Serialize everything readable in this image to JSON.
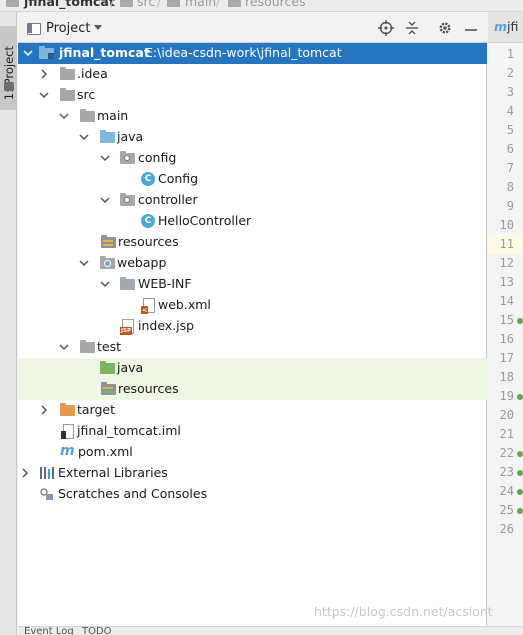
{
  "breadcrumb": {
    "project": "jfinal_tomcat",
    "items": [
      "src",
      "main",
      "resources"
    ]
  },
  "left_stripe": {
    "tab_label": "1: Project"
  },
  "panel": {
    "view_label": "Project"
  },
  "tree": {
    "root_name": "jfinal_tomcat",
    "root_path": "E:\\idea-csdn-work\\jfinal_tomcat",
    "idea": ".idea",
    "src": "src",
    "main": "main",
    "java": "java",
    "config": "config",
    "config_class": "Config",
    "controller": "controller",
    "controller_class": "HelloController",
    "resources": "resources",
    "webapp": "webapp",
    "web_inf": "WEB-INF",
    "web_xml": "web.xml",
    "index_jsp": "index.jsp",
    "test": "test",
    "test_java": "java",
    "test_resources": "resources",
    "target": "target",
    "iml": "jfinal_tomcat.iml",
    "pom": "pom.xml",
    "ext_libs": "External Libraries",
    "scratches": "Scratches and Consoles"
  },
  "editor": {
    "tab_label": "jfi",
    "line_numbers": [
      "1",
      "2",
      "3",
      "4",
      "5",
      "6",
      "7",
      "8",
      "9",
      "10",
      "11",
      "12",
      "13",
      "14",
      "15",
      "16",
      "17",
      "18",
      "19",
      "20",
      "21",
      "22",
      "23",
      "24",
      "25",
      "26"
    ]
  },
  "bottom_tabs": [
    "Event Log",
    "TODO"
  ],
  "watermark": "https://blog.csdn.net/acsiont",
  "colors": {
    "selection": "#2675bf",
    "test_folder_bg": "#eef7e4",
    "module_folder": "#7fb6dc",
    "class_icon": "#4aa8d8"
  }
}
